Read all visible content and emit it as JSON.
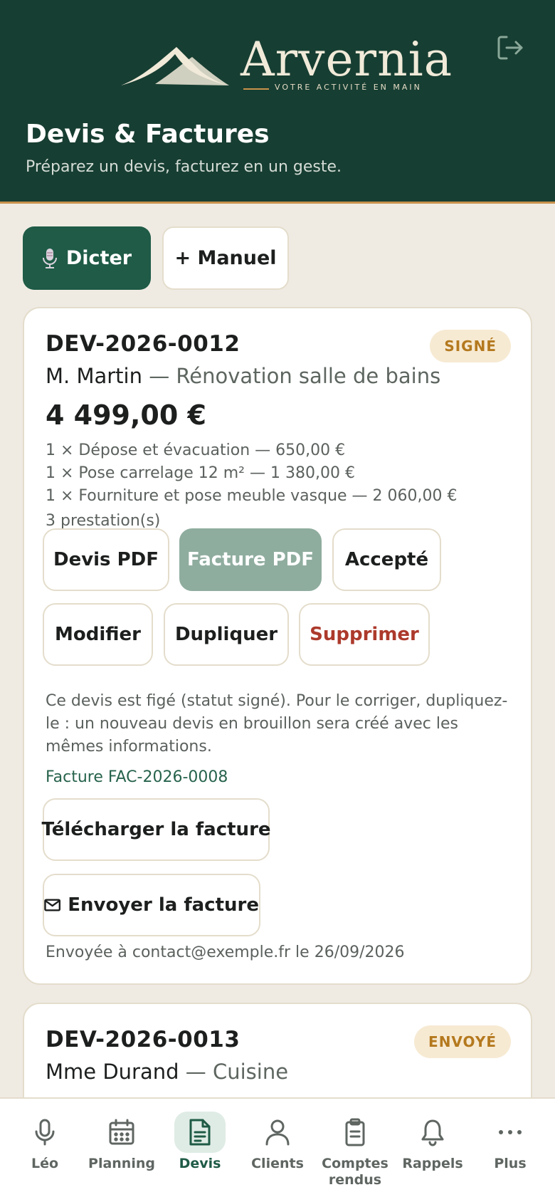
{
  "brand": {
    "name": "Arvernia",
    "tagline": "VOTRE ACTIVITÉ EN MAIN"
  },
  "header": {
    "title": "Devis & Factures",
    "subtitle": "Préparez un devis, facturez en un geste."
  },
  "actions": {
    "dicter": "Dicter",
    "manuel": "+ Manuel"
  },
  "quotes": [
    {
      "ref": "DEV-2026-0012",
      "status": "SIGNÉ",
      "client": "M. Martin",
      "separator": " — ",
      "project": "Rénovation salle de bains",
      "amount": "4 499,00 €",
      "lines": [
        "1 × Dépose et évacuation — 650,00 €",
        "1 × Pose carrelage 12 m² — 1 380,00 €",
        "1 × Fourniture et pose meuble vasque — 2 060,00 €"
      ],
      "count": "3 prestation(s)",
      "buttons": {
        "devis_pdf": "Devis PDF",
        "facture_pdf": "Facture PDF",
        "accepte": "Accepté",
        "modifier": "Modifier",
        "dupliquer": "Dupliquer",
        "supprimer": "Supprimer"
      },
      "note": "Ce devis est figé (statut signé). Pour le corriger, dupliquez-le : un nouveau devis en brouillon sera créé avec les mêmes informations.",
      "invoice_ref": "Facture FAC-2026-0008",
      "download_invoice": "Télécharger la facture",
      "send_invoice": "Envoyer la facture",
      "sent_info": "Envoyée à contact@exemple.fr le 26/09/2026"
    },
    {
      "ref": "DEV-2026-0013",
      "status": "ENVOYÉ",
      "client": "Mme Durand",
      "separator": " — ",
      "project": "Cuisine"
    }
  ],
  "nav": [
    {
      "label": "Léo",
      "icon": "microphone-icon"
    },
    {
      "label": "Planning",
      "icon": "calendar-icon"
    },
    {
      "label": "Devis",
      "icon": "document-icon",
      "active": true
    },
    {
      "label": "Clients",
      "icon": "user-icon"
    },
    {
      "label": "Comptes rendus",
      "icon": "clipboard-icon"
    },
    {
      "label": "Rappels",
      "icon": "bell-icon"
    },
    {
      "label": "Plus",
      "icon": "more-icon"
    }
  ],
  "colors": {
    "header": "#173e32",
    "primary": "#1f5b46",
    "accent": "#c8924a",
    "background": "#efebe3",
    "danger": "#ac3a2c",
    "badge_bg": "#f7ead3",
    "badge_text": "#b4791e"
  }
}
